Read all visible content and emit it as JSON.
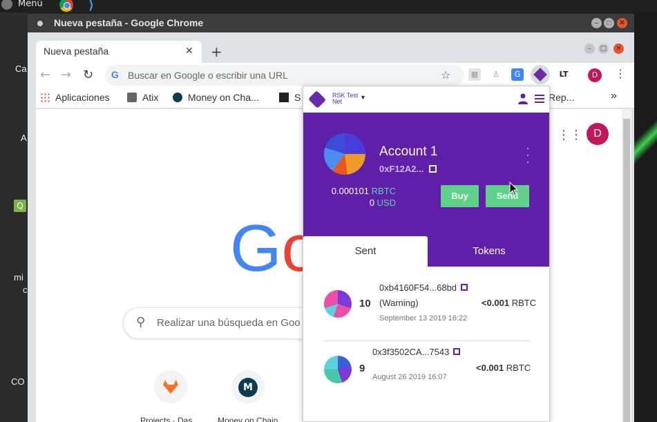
{
  "desktop": {
    "menu_label": "Menú",
    "labels": [
      {
        "text": "Ca"
      },
      {
        "text": "A"
      },
      {
        "text": "Q"
      },
      {
        "text": "mi"
      },
      {
        "text": "c"
      },
      {
        "text": "CO"
      }
    ]
  },
  "window": {
    "title": "Nueva pestaña - Google Chrome"
  },
  "tab": {
    "label": "Nueva pestaña",
    "close": "✕",
    "new": "+"
  },
  "omnibox": {
    "placeholder": "Buscar en Google o escribir una URL"
  },
  "toolbar": {
    "avatar": "D"
  },
  "bookmarks": {
    "items": [
      {
        "label": "Aplicaciones"
      },
      {
        "label": "Atix"
      },
      {
        "label": "Money on Cha..."
      },
      {
        "label": "S"
      },
      {
        "label": "Rep..."
      }
    ],
    "overflow": "»"
  },
  "newtab": {
    "logo": "Go",
    "search_placeholder": "Realizar una búsqueda en Goo",
    "avatar": "D",
    "shortcuts": [
      {
        "label": "Projects · Das..."
      },
      {
        "label": "Money on Chain"
      }
    ]
  },
  "wallet": {
    "network": {
      "line1": "RSK Test",
      "line2": "Net"
    },
    "account": {
      "name": "Account 1",
      "address": "0xF12A2...",
      "balance_main": "0.000101",
      "balance_main_unit": "RBTC",
      "balance_fiat": "0",
      "balance_fiat_unit": "USD"
    },
    "buttons": {
      "buy": "Buy",
      "send": "Send"
    },
    "tabs": {
      "sent": "Sent",
      "tokens": "Tokens"
    },
    "transactions": [
      {
        "nonce": "10",
        "hash": "0xb4160F54...68bd",
        "status": "(Warning)",
        "amount": "<0.001",
        "unit": "RBTC",
        "date": "September 13 2019 16:22"
      },
      {
        "nonce": "9",
        "hash": "0x3f3502CA...7543",
        "status": "",
        "amount": "<0.001",
        "unit": "RBTC",
        "date": "August 26 2019 16:07"
      }
    ]
  }
}
